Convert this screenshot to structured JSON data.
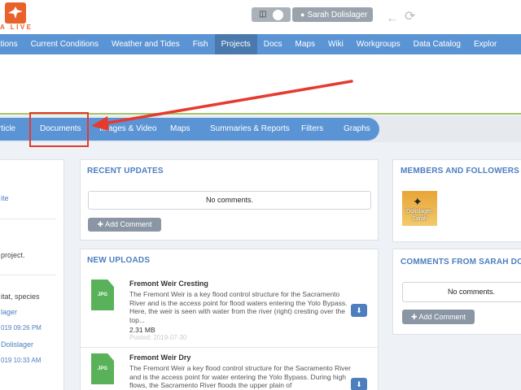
{
  "topbar": {
    "logo_text": "A LIVE",
    "user_label": "Sarah Dolislager",
    "icons": {
      "cart": "basket-icon",
      "user": "user-icon",
      "back": "arrow-left-icon",
      "refresh": "refresh-icon"
    }
  },
  "main_nav": [
    "erations",
    "Current Conditions",
    "Weather and Tides",
    "Fish",
    "Projects",
    "Docs",
    "Maps",
    "Wiki",
    "Workgroups",
    "Data Catalog",
    "Explor"
  ],
  "sub_tabs": [
    "rticle",
    "Documents",
    "Images & Video",
    "Maps",
    "Summaries & Reports",
    "Filters",
    "Graphs"
  ],
  "left_panel": {
    "items": [
      "ite",
      "project.",
      "itat, species",
      "lager",
      "019 09:26 PM",
      "Dolislager",
      "019 10:33 AM"
    ]
  },
  "recent_updates": {
    "title": "RECENT UPDATES",
    "no_comments": "No comments.",
    "add_comment": "Add Comment"
  },
  "new_uploads": {
    "title": "NEW UPLOADS",
    "items": [
      {
        "badge": "JPG",
        "title": "Fremont Weir Cresting",
        "description": "The Fremont Weir is a key flood control structure for the Sacramento River and is the access point for flood waters entering the Yolo Bypass. Here, the weir is seen with water from the river (right) cresting over the top...",
        "size": "2.31 MB",
        "date": "Posted: 2019-07-30"
      },
      {
        "badge": "JPG",
        "title": "Fremont Weir Dry",
        "description": "The Fremont Weir a key flood control structure for the Sacramento River and is the access point for water entering the Yolo Bypass. During high flows, the Sacramento River floods the upper plain of",
        "size": "",
        "date": ""
      }
    ]
  },
  "members": {
    "title": "MEMBERS AND FOLLOWERS",
    "avatar_name": "Dolislager, Sarah"
  },
  "comments": {
    "title": "COMMENTS FROM SARAH DOLIS",
    "no_comments": "No comments.",
    "add_comment": "Add Comment"
  },
  "colors": {
    "nav": "#5b94d4",
    "nav_active": "#4a7aad",
    "accent_title": "#4c7ec0",
    "annotation": "#e53a2e",
    "file_icon": "#59b25a"
  }
}
